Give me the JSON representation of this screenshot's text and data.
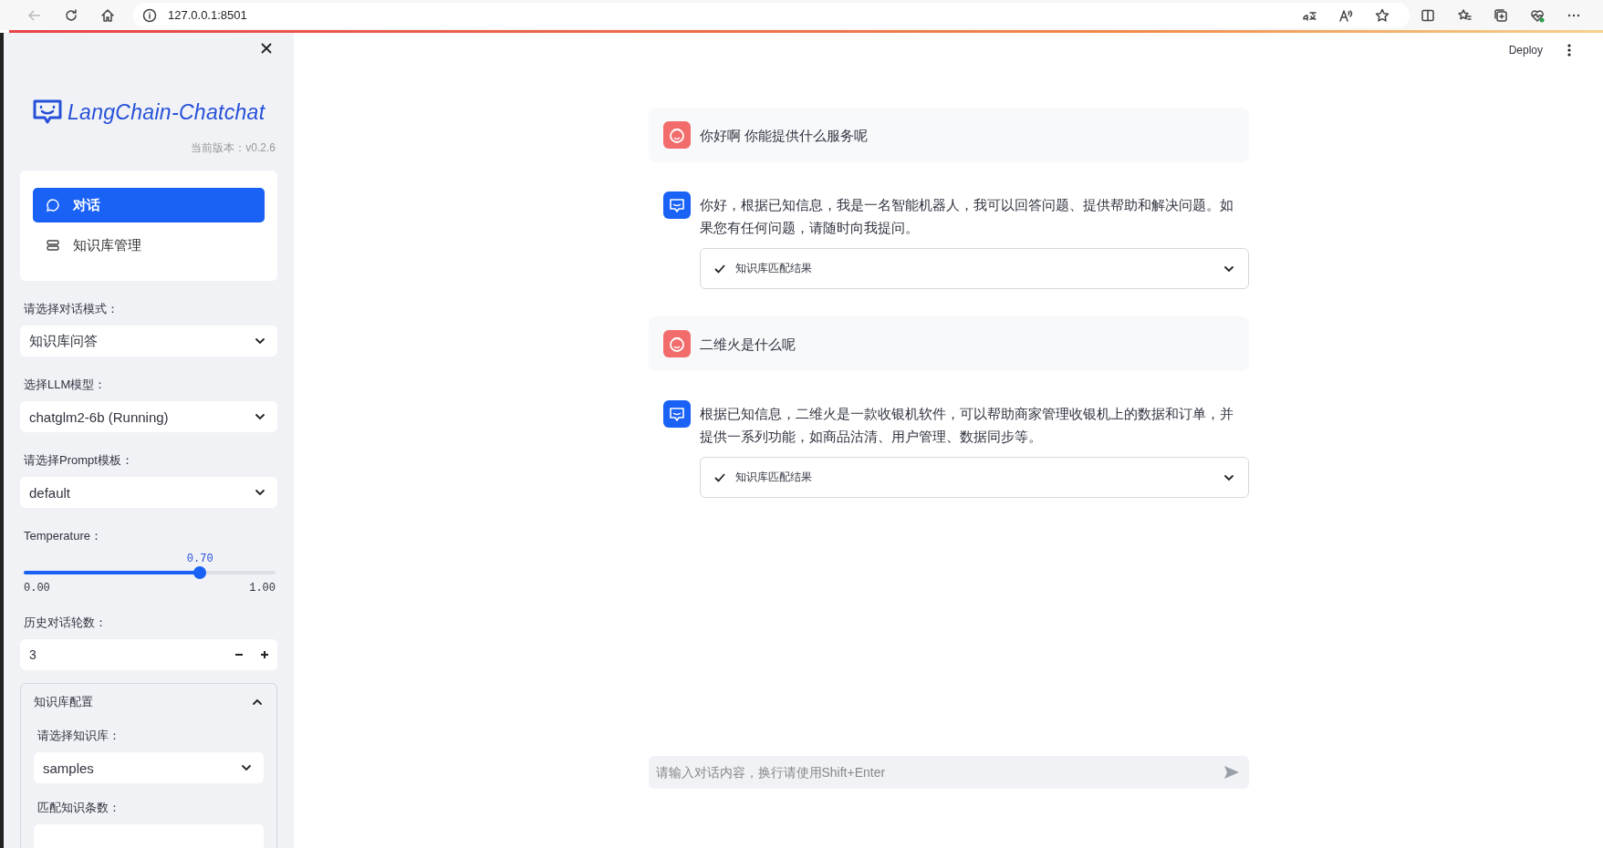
{
  "browser": {
    "url": "127.0.0.1:8501"
  },
  "app_header": {
    "deploy": "Deploy"
  },
  "sidebar": {
    "logo": "LangChain-Chatchat",
    "version": "当前版本：v0.2.6",
    "nav": [
      {
        "label": "对话",
        "selected": true
      },
      {
        "label": "知识库管理",
        "selected": false
      }
    ],
    "controls": [
      {
        "kind": "select",
        "label": "请选择对话模式：",
        "value": "知识库问答"
      },
      {
        "kind": "select",
        "label": "选择LLM模型：",
        "value": "chatglm2-6b (Running)"
      },
      {
        "kind": "select",
        "label": "请选择Prompt模板：",
        "value": "default"
      },
      {
        "kind": "slider",
        "label": "Temperature：",
        "reading": "0.70",
        "min": "0.00",
        "max": "1.00",
        "level": 0.7
      },
      {
        "kind": "number",
        "label": "历史对话轮数：",
        "value": "3"
      },
      {
        "kind": "expander",
        "title": "知识库配置",
        "expanded": true,
        "controls": [
          {
            "kind": "select",
            "label": "请选择知识库：",
            "value": "samples"
          },
          {
            "kind": "field",
            "label": "匹配知识条数："
          }
        ]
      }
    ]
  },
  "chat": {
    "messages": [
      {
        "kind": "user",
        "text": "你好啊 你能提供什么服务呢"
      },
      {
        "kind": "assistant",
        "text": "你好，根据已知信息，我是一名智能机器人，我可以回答问题、提供帮助和解决问题。如果您有任何问题，请随时向我提问。",
        "expander": {
          "title": "知识库匹配结果",
          "done": true,
          "expanded": false
        }
      },
      {
        "kind": "user",
        "text": "二维火是什么呢"
      },
      {
        "kind": "assistant",
        "text": "根据已知信息，二维火是一款收银机软件，可以帮助商家管理收银机上的数据和订单，并提供一系列功能，如商品沽清、用户管理、数据同步等。",
        "expander": {
          "title": "知识库匹配结果",
          "done": true,
          "expanded": false
        }
      }
    ],
    "input": {
      "placeholder": "请输入对话内容，换行请使用Shift+Enter"
    }
  }
}
